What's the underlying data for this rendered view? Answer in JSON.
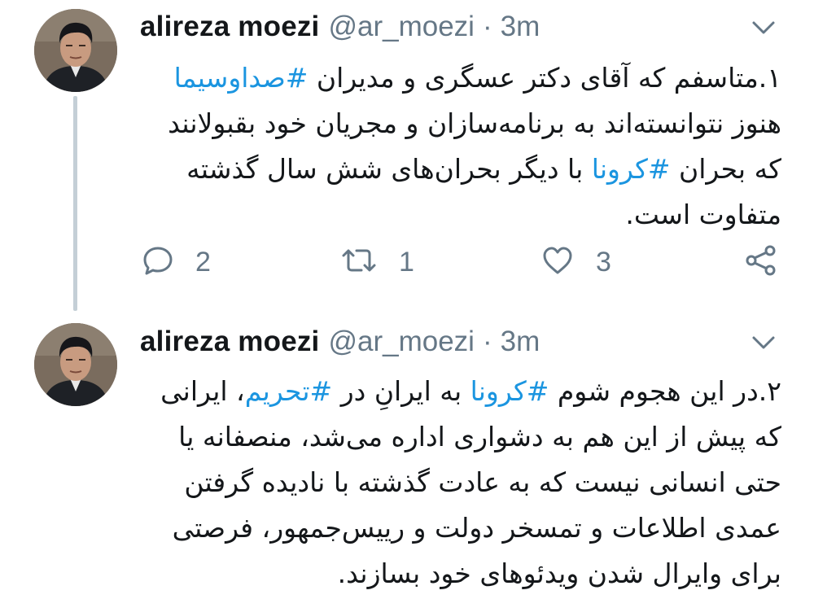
{
  "tweets": [
    {
      "display_name": "alireza moezi",
      "handle": "@ar_moezi",
      "separator": "·",
      "time": "3m",
      "lines": [
        [
          {
            "t": "۱.متاسفم که آقای دکتر عسگری و مدیران ",
            "tag": false
          },
          {
            "t": "#صداوسیما",
            "tag": true
          }
        ],
        [
          {
            "t": "هنوز نتوانسته‌اند به برنامه‌سازان و مجریان خود بقبولانند",
            "tag": false
          }
        ],
        [
          {
            "t": "که بحران ",
            "tag": false
          },
          {
            "t": "#کرونا",
            "tag": true
          },
          {
            "t": " با دیگر بحران‌های شش سال گذشته",
            "tag": false
          }
        ],
        [
          {
            "t": "متفاوت است.",
            "tag": false
          }
        ]
      ],
      "counts": {
        "reply": "2",
        "retweet": "1",
        "like": "3"
      }
    },
    {
      "display_name": "alireza moezi",
      "handle": "@ar_moezi",
      "separator": "·",
      "time": "3m",
      "lines": [
        [
          {
            "t": "۲.در این هجوم شوم ",
            "tag": false
          },
          {
            "t": "#کرونا",
            "tag": true
          },
          {
            "t": " به ایرانِ در ",
            "tag": false
          },
          {
            "t": "#تحریم",
            "tag": true
          },
          {
            "t": "، ایرانی",
            "tag": false
          }
        ],
        [
          {
            "t": "که پیش از این هم به دشواری اداره می‌شد، منصفانه یا",
            "tag": false
          }
        ],
        [
          {
            "t": "حتی انسانی نیست که به عادت گذشته با نادیده گرفتن",
            "tag": false
          }
        ],
        [
          {
            "t": "عمدی اطلاعات و تمسخر دولت و رییس‌جمهور، فرصتی",
            "tag": false
          }
        ],
        [
          {
            "t": "برای وایرال شدن ویدئوهای خود بسازند.",
            "tag": false
          }
        ]
      ]
    }
  ],
  "icons": {
    "reply": "reply-icon",
    "retweet": "retweet-icon",
    "like": "heart-icon",
    "share": "share-icon",
    "more": "chevron-down-icon"
  },
  "colors": {
    "text": "#14171a",
    "secondary": "#657786",
    "hashtag": "#1b95e0",
    "thread_line": "#c4cfd6",
    "background": "#ffffff"
  }
}
